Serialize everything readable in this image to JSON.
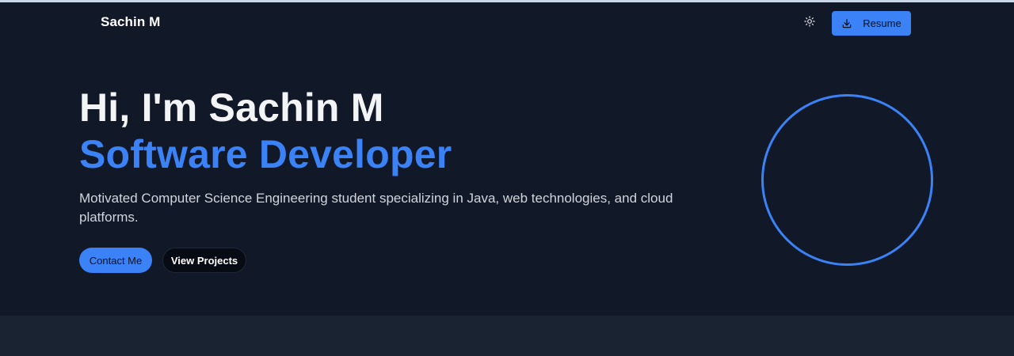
{
  "header": {
    "brand": "Sachin M",
    "theme_icon": "sun-icon",
    "resume_label": "Resume",
    "resume_icon": "download-icon"
  },
  "hero": {
    "greeting": "Hi, I'm Sachin M",
    "role": "Software Developer",
    "description": "Motivated Computer Science Engineering student specializing in Java, web technologies, and cloud platforms.",
    "contact_label": "Contact Me",
    "projects_label": "View Projects"
  },
  "colors": {
    "background": "#111827",
    "accent": "#3b82f6",
    "section_alt": "#1a2332"
  }
}
